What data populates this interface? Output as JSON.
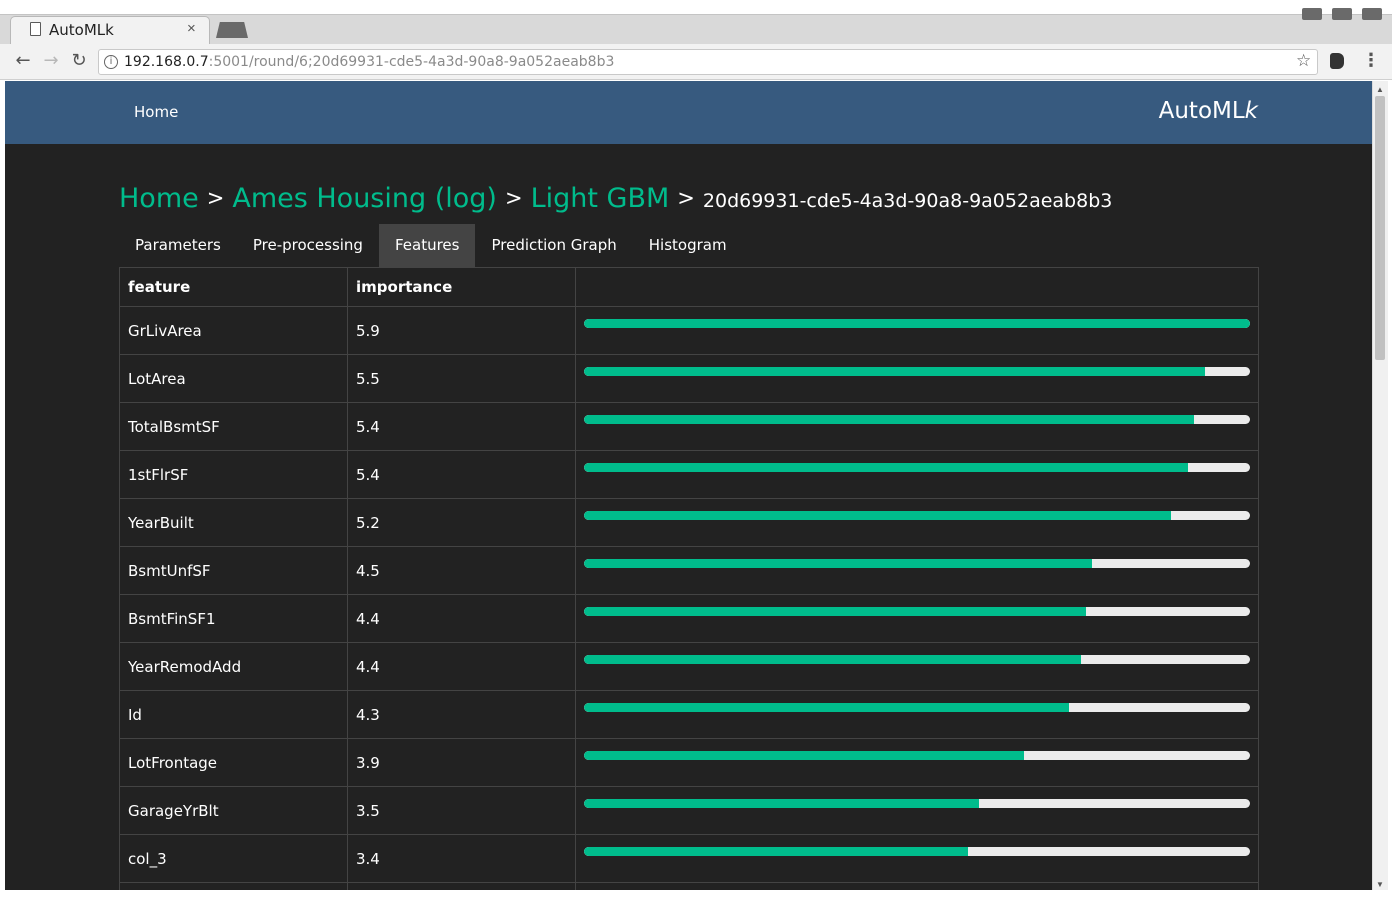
{
  "browser": {
    "tab_title": "AutoMLk",
    "tab_close": "×",
    "url_host": "192.168.0.7",
    "url_path": ":5001/round/6;20d69931-cde5-4a3d-90a8-9a052aeab8b3",
    "back_glyph": "←",
    "forward_glyph": "→",
    "reload_glyph": "↻",
    "info_glyph": "i",
    "star_glyph": "☆",
    "menu_glyph": "⋮"
  },
  "navbar": {
    "home_label": "Home",
    "brand_main": "AutoML",
    "brand_italic": "k",
    "background_color": "#375a7f"
  },
  "breadcrumb": {
    "items": [
      "Home",
      "Ames Housing (log)",
      "Light GBM"
    ],
    "separator": ">",
    "current": "20d69931-cde5-4a3d-90a8-9a052aeab8b3",
    "link_color": "#00bc8c"
  },
  "tabs": [
    {
      "label": "Parameters"
    },
    {
      "label": "Pre-processing"
    },
    {
      "label": "Features",
      "active": true
    },
    {
      "label": "Prediction Graph"
    },
    {
      "label": "Histogram"
    }
  ],
  "table": {
    "headers": [
      "feature",
      "importance",
      ""
    ],
    "max_importance": 5.9,
    "bar_color": "#00bc8c",
    "bar_track_color": "#ebebeb",
    "rows": [
      {
        "feature": "GrLivArea",
        "importance": "5.9",
        "value": 5.9
      },
      {
        "feature": "LotArea",
        "importance": "5.5",
        "value": 5.5
      },
      {
        "feature": "TotalBsmtSF",
        "importance": "5.4",
        "value": 5.4
      },
      {
        "feature": "1stFlrSF",
        "importance": "5.4",
        "value": 5.35
      },
      {
        "feature": "YearBuilt",
        "importance": "5.2",
        "value": 5.2
      },
      {
        "feature": "BsmtUnfSF",
        "importance": "4.5",
        "value": 4.5
      },
      {
        "feature": "BsmtFinSF1",
        "importance": "4.4",
        "value": 4.45
      },
      {
        "feature": "YearRemodAdd",
        "importance": "4.4",
        "value": 4.4
      },
      {
        "feature": "Id",
        "importance": "4.3",
        "value": 4.3
      },
      {
        "feature": "LotFrontage",
        "importance": "3.9",
        "value": 3.9
      },
      {
        "feature": "GarageYrBlt",
        "importance": "3.5",
        "value": 3.5
      },
      {
        "feature": "col_3",
        "importance": "3.4",
        "value": 3.4
      },
      {
        "feature": "",
        "importance": "",
        "value": 0
      }
    ]
  }
}
